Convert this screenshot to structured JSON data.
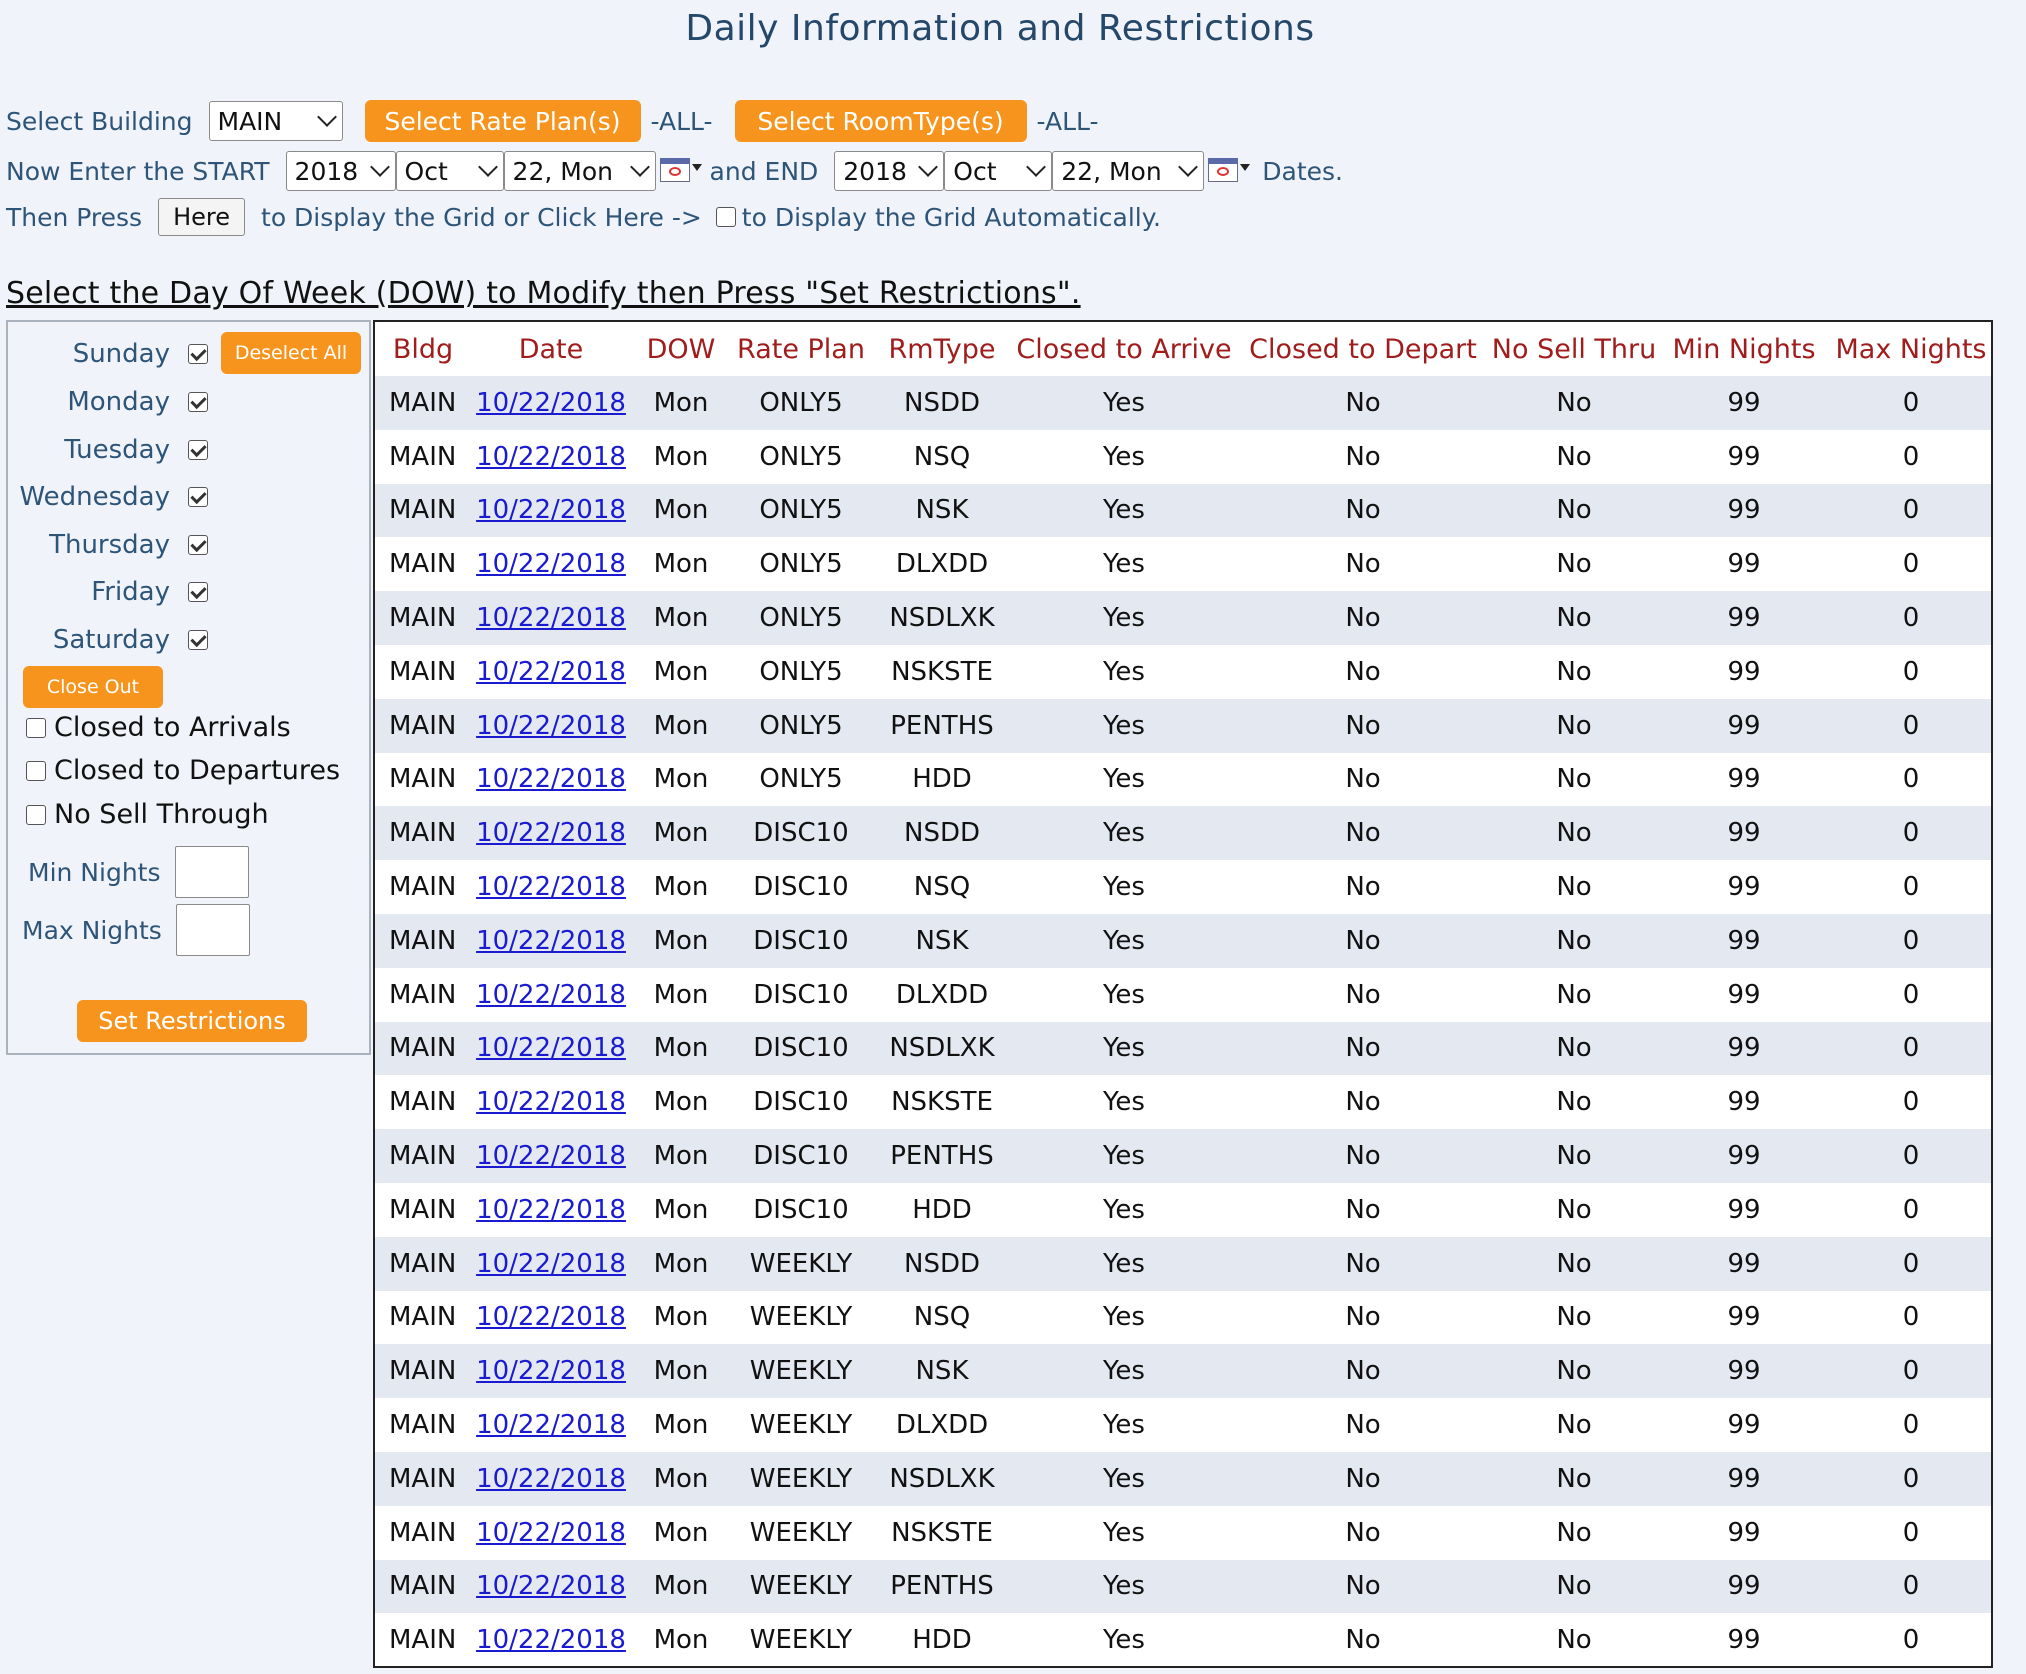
{
  "title": "Daily Information and Restrictions",
  "controls": {
    "select_building_label": "Select Building",
    "building_value": "MAIN",
    "rate_plan_btn": "Select Rate Plan(s)",
    "rate_plan_all": "-ALL-",
    "roomtype_btn": "Select RoomType(s)",
    "roomtype_all": "-ALL-",
    "start_label": "Now Enter the START",
    "start_year": "2018",
    "start_month": "Oct",
    "start_day": "22, Mon",
    "end_label": "and END",
    "end_year": "2018",
    "end_month": "Oct",
    "end_day": "22, Mon",
    "dates_label": "Dates.",
    "then_press": "Then Press",
    "here_btn": "Here",
    "display_text": "to Display the Grid or Click Here ->",
    "auto_text": "to Display the Grid Automatically."
  },
  "heading": "Select the Day Of Week (DOW) to Modify then Press \"Set Restrictions\".",
  "left_panel": {
    "days": [
      {
        "label": "Sunday",
        "checked": true
      },
      {
        "label": "Monday",
        "checked": true
      },
      {
        "label": "Tuesday",
        "checked": true
      },
      {
        "label": "Wednesday",
        "checked": true
      },
      {
        "label": "Thursday",
        "checked": true
      },
      {
        "label": "Friday",
        "checked": true
      },
      {
        "label": "Saturday",
        "checked": true
      }
    ],
    "deselect_all": "Deselect All",
    "close_out": "Close Out",
    "closed_arrivals": "Closed to Arrivals",
    "closed_departures": "Closed to Departures",
    "no_sell_through": "No Sell Through",
    "min_nights": "Min Nights",
    "max_nights": "Max Nights",
    "set_restrictions": "Set Restrictions"
  },
  "table": {
    "headers": [
      "Bldg",
      "Date",
      "DOW",
      "Rate Plan",
      "RmType",
      "Closed to Arrive",
      "Closed to Depart",
      "No Sell Thru",
      "Min Nights",
      "Max Nights"
    ],
    "rows": [
      [
        "MAIN",
        "10/22/2018",
        "Mon",
        "ONLY5",
        "NSDD",
        "Yes",
        "No",
        "No",
        "99",
        "0"
      ],
      [
        "MAIN",
        "10/22/2018",
        "Mon",
        "ONLY5",
        "NSQ",
        "Yes",
        "No",
        "No",
        "99",
        "0"
      ],
      [
        "MAIN",
        "10/22/2018",
        "Mon",
        "ONLY5",
        "NSK",
        "Yes",
        "No",
        "No",
        "99",
        "0"
      ],
      [
        "MAIN",
        "10/22/2018",
        "Mon",
        "ONLY5",
        "DLXDD",
        "Yes",
        "No",
        "No",
        "99",
        "0"
      ],
      [
        "MAIN",
        "10/22/2018",
        "Mon",
        "ONLY5",
        "NSDLXK",
        "Yes",
        "No",
        "No",
        "99",
        "0"
      ],
      [
        "MAIN",
        "10/22/2018",
        "Mon",
        "ONLY5",
        "NSKSTE",
        "Yes",
        "No",
        "No",
        "99",
        "0"
      ],
      [
        "MAIN",
        "10/22/2018",
        "Mon",
        "ONLY5",
        "PENTHS",
        "Yes",
        "No",
        "No",
        "99",
        "0"
      ],
      [
        "MAIN",
        "10/22/2018",
        "Mon",
        "ONLY5",
        "HDD",
        "Yes",
        "No",
        "No",
        "99",
        "0"
      ],
      [
        "MAIN",
        "10/22/2018",
        "Mon",
        "DISC10",
        "NSDD",
        "Yes",
        "No",
        "No",
        "99",
        "0"
      ],
      [
        "MAIN",
        "10/22/2018",
        "Mon",
        "DISC10",
        "NSQ",
        "Yes",
        "No",
        "No",
        "99",
        "0"
      ],
      [
        "MAIN",
        "10/22/2018",
        "Mon",
        "DISC10",
        "NSK",
        "Yes",
        "No",
        "No",
        "99",
        "0"
      ],
      [
        "MAIN",
        "10/22/2018",
        "Mon",
        "DISC10",
        "DLXDD",
        "Yes",
        "No",
        "No",
        "99",
        "0"
      ],
      [
        "MAIN",
        "10/22/2018",
        "Mon",
        "DISC10",
        "NSDLXK",
        "Yes",
        "No",
        "No",
        "99",
        "0"
      ],
      [
        "MAIN",
        "10/22/2018",
        "Mon",
        "DISC10",
        "NSKSTE",
        "Yes",
        "No",
        "No",
        "99",
        "0"
      ],
      [
        "MAIN",
        "10/22/2018",
        "Mon",
        "DISC10",
        "PENTHS",
        "Yes",
        "No",
        "No",
        "99",
        "0"
      ],
      [
        "MAIN",
        "10/22/2018",
        "Mon",
        "DISC10",
        "HDD",
        "Yes",
        "No",
        "No",
        "99",
        "0"
      ],
      [
        "MAIN",
        "10/22/2018",
        "Mon",
        "WEEKLY",
        "NSDD",
        "Yes",
        "No",
        "No",
        "99",
        "0"
      ],
      [
        "MAIN",
        "10/22/2018",
        "Mon",
        "WEEKLY",
        "NSQ",
        "Yes",
        "No",
        "No",
        "99",
        "0"
      ],
      [
        "MAIN",
        "10/22/2018",
        "Mon",
        "WEEKLY",
        "NSK",
        "Yes",
        "No",
        "No",
        "99",
        "0"
      ],
      [
        "MAIN",
        "10/22/2018",
        "Mon",
        "WEEKLY",
        "DLXDD",
        "Yes",
        "No",
        "No",
        "99",
        "0"
      ],
      [
        "MAIN",
        "10/22/2018",
        "Mon",
        "WEEKLY",
        "NSDLXK",
        "Yes",
        "No",
        "No",
        "99",
        "0"
      ],
      [
        "MAIN",
        "10/22/2018",
        "Mon",
        "WEEKLY",
        "NSKSTE",
        "Yes",
        "No",
        "No",
        "99",
        "0"
      ],
      [
        "MAIN",
        "10/22/2018",
        "Mon",
        "WEEKLY",
        "PENTHS",
        "Yes",
        "No",
        "No",
        "99",
        "0"
      ],
      [
        "MAIN",
        "10/22/2018",
        "Mon",
        "WEEKLY",
        "HDD",
        "Yes",
        "No",
        "No",
        "99",
        "0"
      ]
    ]
  }
}
